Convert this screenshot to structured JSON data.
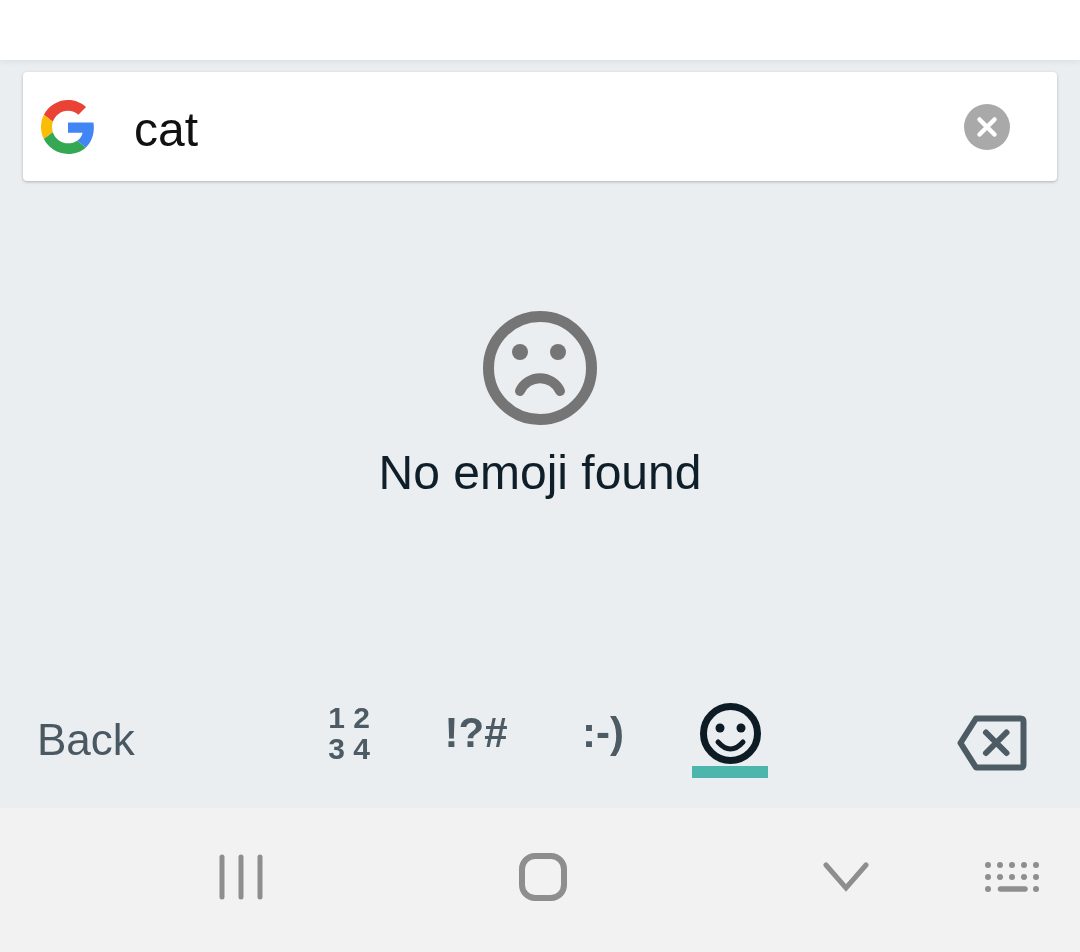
{
  "search": {
    "value": "cat"
  },
  "results": {
    "message": "No emoji found"
  },
  "emoji_bar": {
    "back_button": {
      "label": "Back"
    },
    "tabs": [
      {
        "kind": "stacked",
        "lines": [
          "1 2",
          "3 4"
        ],
        "selected": false
      },
      {
        "kind": "text",
        "label": "!?#",
        "selected": false
      },
      {
        "kind": "text",
        "label": ":-)",
        "selected": false
      },
      {
        "kind": "icon",
        "selected": true
      }
    ]
  }
}
